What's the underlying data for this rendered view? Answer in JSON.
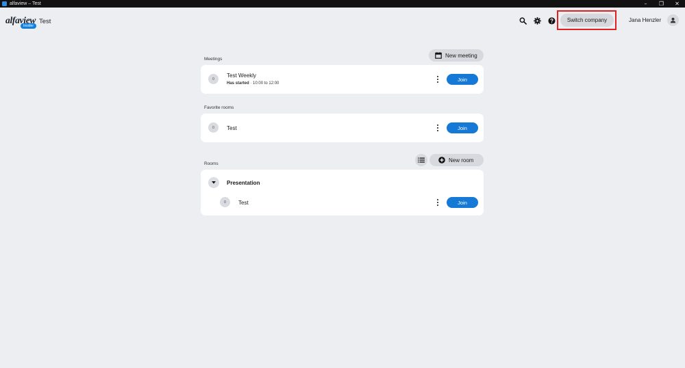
{
  "window": {
    "title": "alfaview – Test",
    "controls": {
      "minimize": "–",
      "restore": "❐",
      "close": "✕"
    }
  },
  "header": {
    "logo_text": "alfaview",
    "logo_badge": "Insider",
    "company_name": "Test",
    "switch_company_label": "Switch company",
    "user_name": "Jana Henzler",
    "icons": [
      "search-icon",
      "gear-icon",
      "help-icon",
      "user-avatar-icon"
    ]
  },
  "meetings": {
    "label": "Meetings",
    "new_button_label": "New meeting",
    "items": [
      {
        "avatar": "0",
        "title": "Test Weekly",
        "status": "Has started",
        "time": "· 10:00 to 12:00",
        "join_label": "Join"
      }
    ]
  },
  "favorites": {
    "label": "Favorite rooms",
    "items": [
      {
        "avatar": "0",
        "title": "Test",
        "join_label": "Join"
      }
    ]
  },
  "rooms": {
    "label": "Rooms",
    "new_button_label": "New room",
    "groups": [
      {
        "title": "Presentation",
        "items": [
          {
            "avatar": "0",
            "title": "Test",
            "join_label": "Join"
          }
        ]
      }
    ]
  },
  "colors": {
    "background": "#eceef2",
    "accent": "#1679d6",
    "highlight": "#e12020"
  }
}
